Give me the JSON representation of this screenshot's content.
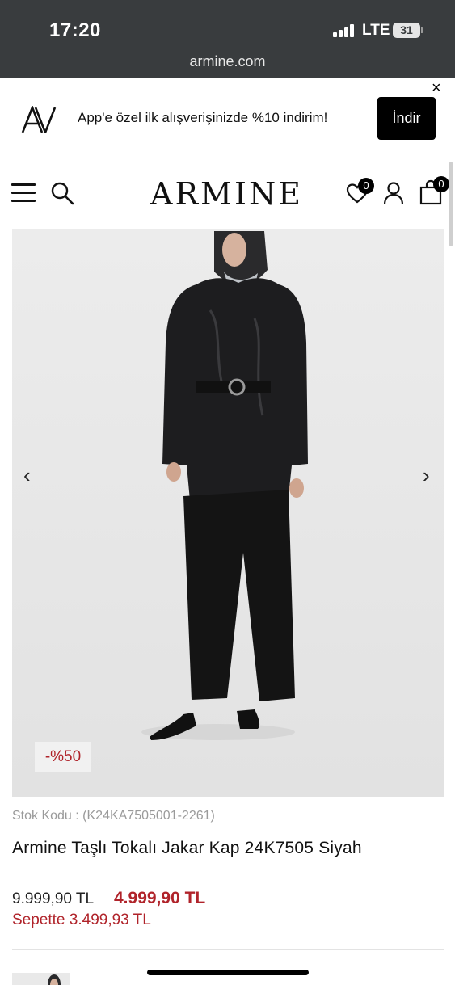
{
  "status_bar": {
    "time": "17:20",
    "network": "LTE",
    "battery": "31"
  },
  "browser": {
    "url": "armine.com"
  },
  "app_banner": {
    "logo_text": "AV",
    "message": "App'e özel ilk alışverişinizde %10 indirim!",
    "download_label": "İndir",
    "close_label": "×"
  },
  "header": {
    "logo": "ARMINE",
    "wishlist_count": "0",
    "cart_count": "0",
    "icons": [
      "menu-icon",
      "search-icon",
      "heart-icon",
      "user-icon",
      "bag-icon"
    ]
  },
  "gallery": {
    "prev_label": "‹",
    "next_label": "›",
    "discount_badge": "-%50"
  },
  "product": {
    "stock_code": "Stok Kodu : (K24KA7505001-2261)",
    "title": "Armine Taşlı Tokalı Jakar Kap 24K7505 Siyah",
    "old_price": "9.999,90 TL",
    "price": "4.999,90 TL",
    "basket_price": "Sepette 3.499,93 TL"
  },
  "colors": {
    "accent_red": "#b0232a",
    "dark_bar": "#393c3e",
    "image_bg": "#e8e8e8"
  }
}
